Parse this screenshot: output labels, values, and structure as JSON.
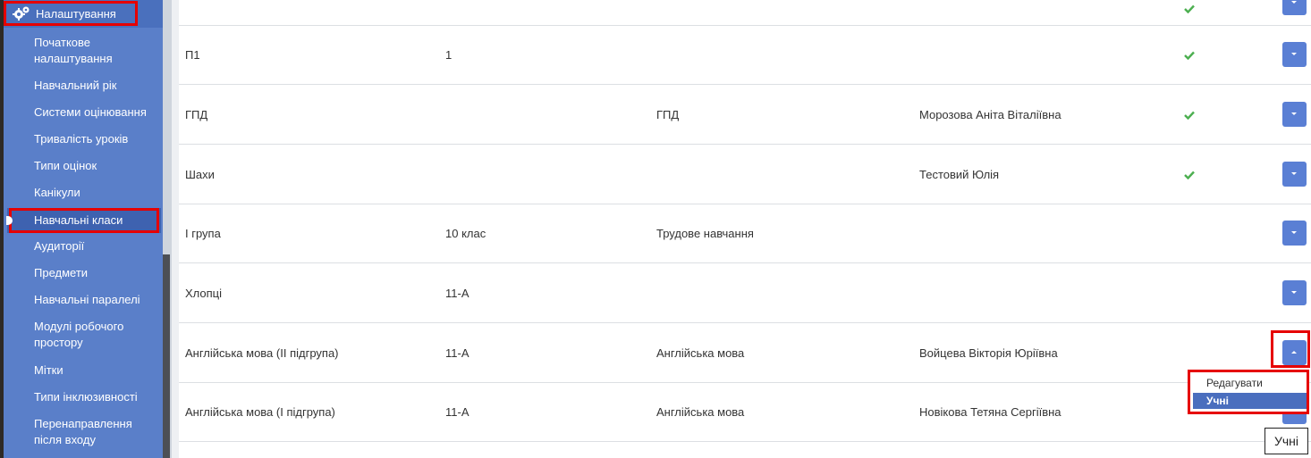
{
  "sidebar": {
    "title": "Налаштування",
    "items": [
      {
        "label": "Початкове налаштування"
      },
      {
        "label": "Навчальний рік"
      },
      {
        "label": "Системи оцінювання"
      },
      {
        "label": "Тривалість уроків"
      },
      {
        "label": "Типи оцінок"
      },
      {
        "label": "Канікули"
      },
      {
        "label": "Навчальні класи"
      },
      {
        "label": "Аудиторії"
      },
      {
        "label": "Предмети"
      },
      {
        "label": "Навчальні паралелі"
      },
      {
        "label": "Модулі робочого простору"
      },
      {
        "label": "Мітки"
      },
      {
        "label": "Типи інклюзивності"
      },
      {
        "label": "Перенаправлення після входу"
      }
    ],
    "active_item": "Навчальні класи"
  },
  "table": {
    "rows": [
      {
        "name": "",
        "class": "",
        "subject": "",
        "teacher": "",
        "active": true
      },
      {
        "name": "П1",
        "class": "1",
        "subject": "",
        "teacher": "",
        "active": true
      },
      {
        "name": "ГПД",
        "class": "",
        "subject": "ГПД",
        "teacher": "Морозова Аніта Віталіївна",
        "active": true
      },
      {
        "name": "Шахи",
        "class": "",
        "subject": "",
        "teacher": "Тестовий Юлія",
        "active": true
      },
      {
        "name": "І група",
        "class": "10 клас",
        "subject": "Трудове навчання",
        "teacher": "",
        "active": false
      },
      {
        "name": "Хлопці",
        "class": "11-А",
        "subject": "",
        "teacher": "",
        "active": false
      },
      {
        "name": "Англійська мова (ІІ підгрупа)",
        "class": "11-А",
        "subject": "Англійська мова",
        "teacher": "Войцева Вікторія Юріївна",
        "active": false
      },
      {
        "name": "Англійська мова (І підгрупа)",
        "class": "11-А",
        "subject": "Англійська мова",
        "teacher": "Новікова Тетяна Сергіївна",
        "active": false
      }
    ]
  },
  "dropdown_menu": {
    "items": [
      "Редагувати",
      "Учні"
    ],
    "selected": "Учні"
  },
  "tooltip": "Учні",
  "colors": {
    "sidebar_bg": "#5a7fc9",
    "accent": "#5a7fd4",
    "highlight": "#e60000",
    "check": "#4caf50"
  }
}
